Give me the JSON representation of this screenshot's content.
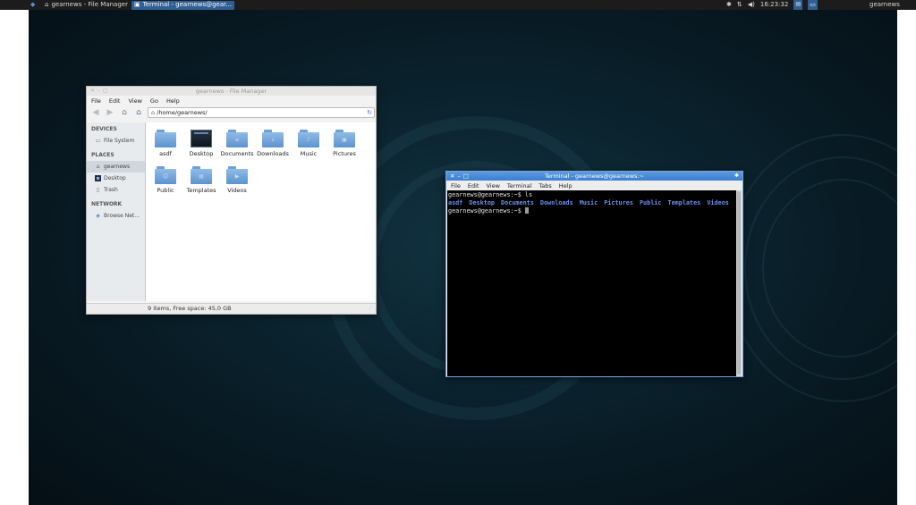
{
  "panel": {
    "tasks": [
      {
        "label": "gearnews - File Manager",
        "icon": "home-icon",
        "active": false
      },
      {
        "label": "Terminal - gearnews@gear...",
        "icon": "terminal-icon",
        "active": true
      }
    ],
    "clock": "16:23:32",
    "user": "gearnews"
  },
  "file_manager": {
    "title": "gearnews - File Manager",
    "menu": [
      "File",
      "Edit",
      "View",
      "Go",
      "Help"
    ],
    "location": "/home/gearnews/",
    "sidebar": {
      "devices_header": "DEVICES",
      "devices": [
        {
          "label": "File System",
          "icon": "drive-icon"
        }
      ],
      "places_header": "PLACES",
      "places": [
        {
          "label": "gearnews",
          "icon": "home-icon"
        },
        {
          "label": "Desktop",
          "icon": "desktop-icon"
        },
        {
          "label": "Trash",
          "icon": "trash-icon"
        }
      ],
      "network_header": "NETWORK",
      "network": [
        {
          "label": "Browse Net...",
          "icon": "network-icon"
        }
      ]
    },
    "files": [
      "asdf",
      "Desktop",
      "Documents",
      "Downloads",
      "Music",
      "Pictures",
      "Public",
      "Templates",
      "Videos"
    ],
    "status": "9 items, Free space: 45,0 GB"
  },
  "terminal": {
    "title": "Terminal - gearnews@gearnews:~",
    "menu": [
      "File",
      "Edit",
      "View",
      "Terminal",
      "Tabs",
      "Help"
    ],
    "line1": "gearnews@gearnews:~$ ls",
    "ls_output": [
      "asdf",
      "Desktop",
      "Documents",
      "Downloads",
      "Music",
      "Pictures",
      "Public",
      "Templates",
      "Videos"
    ],
    "prompt": "gearnews@gearnews:~$ "
  }
}
